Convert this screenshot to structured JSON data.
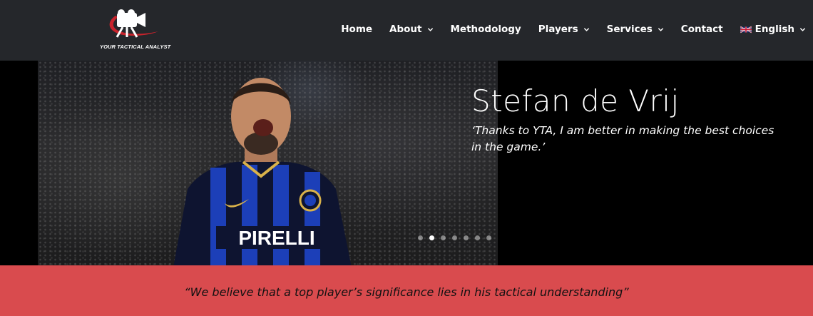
{
  "header": {
    "logo_text": "YOUR TACTICAL ANALYST",
    "nav": [
      {
        "label": "Home",
        "has_dropdown": false
      },
      {
        "label": "About",
        "has_dropdown": true
      },
      {
        "label": "Methodology",
        "has_dropdown": false
      },
      {
        "label": "Players",
        "has_dropdown": true
      },
      {
        "label": "Services",
        "has_dropdown": true
      },
      {
        "label": "Contact",
        "has_dropdown": false
      },
      {
        "label": "English",
        "has_dropdown": true,
        "icon": "uk-flag-icon"
      }
    ]
  },
  "hero": {
    "name": "Stefan de Vrij",
    "quote": "‘Thanks to YTA, I am better in making the best choices in the game.’",
    "jersey_sponsor": "PIRELLI",
    "slides_count": 7,
    "active_slide": 2
  },
  "banner": {
    "text": "“We believe that a top player’s significance lies in his tactical understanding”"
  },
  "colors": {
    "header_bg": "#25272b",
    "banner_bg": "#d94b4e",
    "logo_accent": "#c8232c"
  }
}
